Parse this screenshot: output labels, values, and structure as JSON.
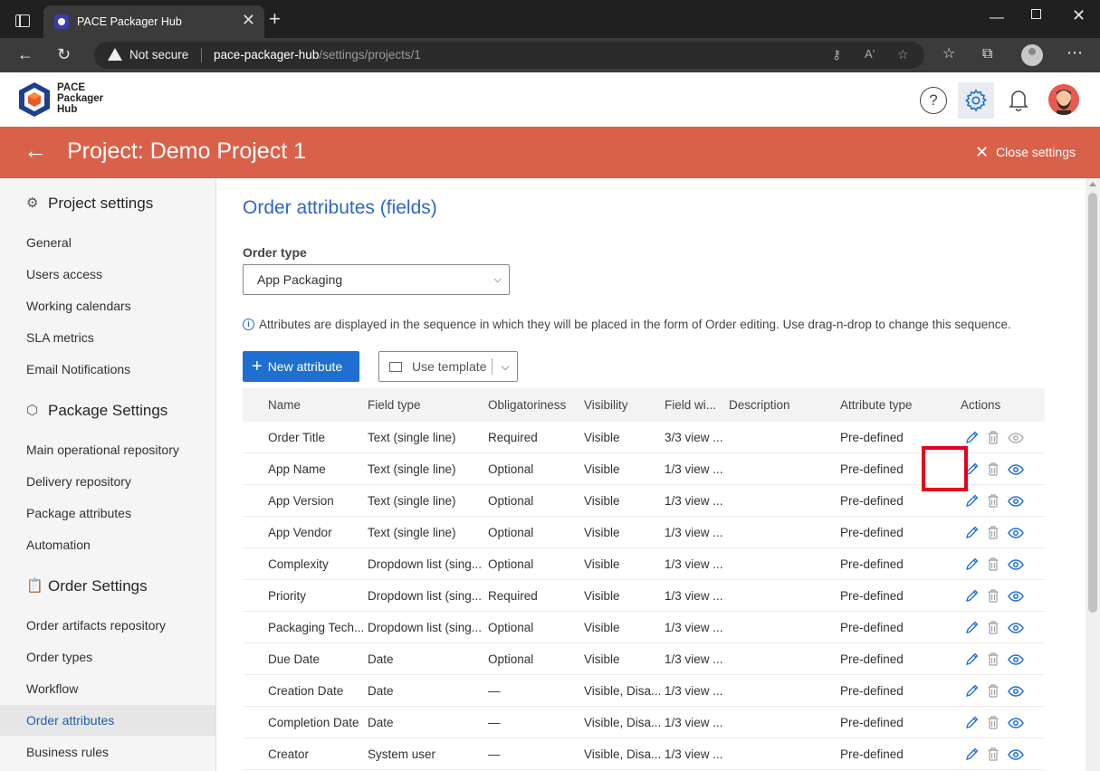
{
  "browser": {
    "tab_title": "PACE Packager Hub",
    "tab_close": "✕",
    "new_tab": "+",
    "security": "Not secure",
    "url_host": "pace-packager-hub",
    "url_path": "/settings/projects/1"
  },
  "app": {
    "logo_lines": [
      "PACE",
      "Packager",
      "Hub"
    ],
    "help": "?"
  },
  "banner": {
    "title": "Project: Demo Project 1",
    "close_label": "Close settings"
  },
  "sidebar": {
    "sections": [
      {
        "title": "Project settings",
        "icon": "gear-icon",
        "items": [
          "General",
          "Users access",
          "Working calendars",
          "SLA metrics",
          "Email Notifications"
        ]
      },
      {
        "title": "Package Settings",
        "icon": "package-icon",
        "items": [
          "Main operational repository",
          "Delivery repository",
          "Package attributes",
          "Automation"
        ]
      },
      {
        "title": "Order Settings",
        "icon": "clipboard-icon",
        "items": [
          "Order artifacts repository",
          "Order types",
          "Workflow",
          "Order attributes",
          "Business rules"
        ]
      }
    ],
    "active_item": "Order attributes"
  },
  "main": {
    "title": "Order attributes (fields)",
    "order_type_label": "Order type",
    "order_type_value": "App Packaging",
    "info_text": "Attributes are displayed in the sequence in which they will be placed in the form of Order editing. Use drag-n-drop to change this sequence.",
    "new_attribute_label": "New attribute",
    "use_template_label": "Use template"
  },
  "table": {
    "columns": [
      "Name",
      "Field type",
      "Obligatoriness",
      "Visibility",
      "Field wi...",
      "Description",
      "Attribute type",
      "Actions"
    ],
    "rows": [
      {
        "name": "Order Title",
        "type": "Text (single line)",
        "obl": "Required",
        "vis": "Visible",
        "width": "3/3 view ...",
        "desc": "",
        "attr": "Pre-defined",
        "view_enabled": false
      },
      {
        "name": "App Name",
        "type": "Text (single line)",
        "obl": "Optional",
        "vis": "Visible",
        "width": "1/3 view ...",
        "desc": "",
        "attr": "Pre-defined",
        "view_enabled": true
      },
      {
        "name": "App Version",
        "type": "Text (single line)",
        "obl": "Optional",
        "vis": "Visible",
        "width": "1/3 view ...",
        "desc": "",
        "attr": "Pre-defined",
        "view_enabled": true
      },
      {
        "name": "App Vendor",
        "type": "Text (single line)",
        "obl": "Optional",
        "vis": "Visible",
        "width": "1/3 view ...",
        "desc": "",
        "attr": "Pre-defined",
        "view_enabled": true
      },
      {
        "name": "Complexity",
        "type": "Dropdown list (sing...",
        "obl": "Optional",
        "vis": "Visible",
        "width": "1/3 view ...",
        "desc": "",
        "attr": "Pre-defined",
        "view_enabled": true
      },
      {
        "name": "Priority",
        "type": "Dropdown list (sing...",
        "obl": "Required",
        "vis": "Visible",
        "width": "1/3 view ...",
        "desc": "",
        "attr": "Pre-defined",
        "view_enabled": true
      },
      {
        "name": "Packaging Tech...",
        "type": "Dropdown list (sing...",
        "obl": "Optional",
        "vis": "Visible",
        "width": "1/3 view ...",
        "desc": "",
        "attr": "Pre-defined",
        "view_enabled": true
      },
      {
        "name": "Due Date",
        "type": "Date",
        "obl": "Optional",
        "vis": "Visible",
        "width": "1/3 view ...",
        "desc": "",
        "attr": "Pre-defined",
        "view_enabled": true
      },
      {
        "name": "Creation Date",
        "type": "Date",
        "obl": "—",
        "vis": "Visible, Disa...",
        "width": "1/3 view ...",
        "desc": "",
        "attr": "Pre-defined",
        "view_enabled": true
      },
      {
        "name": "Completion Date",
        "type": "Date",
        "obl": "—",
        "vis": "Visible, Disa...",
        "width": "1/3 view ...",
        "desc": "",
        "attr": "Pre-defined",
        "view_enabled": true
      },
      {
        "name": "Creator",
        "type": "System user",
        "obl": "—",
        "vis": "Visible, Disa...",
        "width": "1/3 view ...",
        "desc": "",
        "attr": "Pre-defined",
        "view_enabled": true
      }
    ]
  },
  "colors": {
    "banner": "#d9614a",
    "accent": "#1e6fd0",
    "title_blue": "#2f66c4",
    "highlight": "#e6001e"
  }
}
